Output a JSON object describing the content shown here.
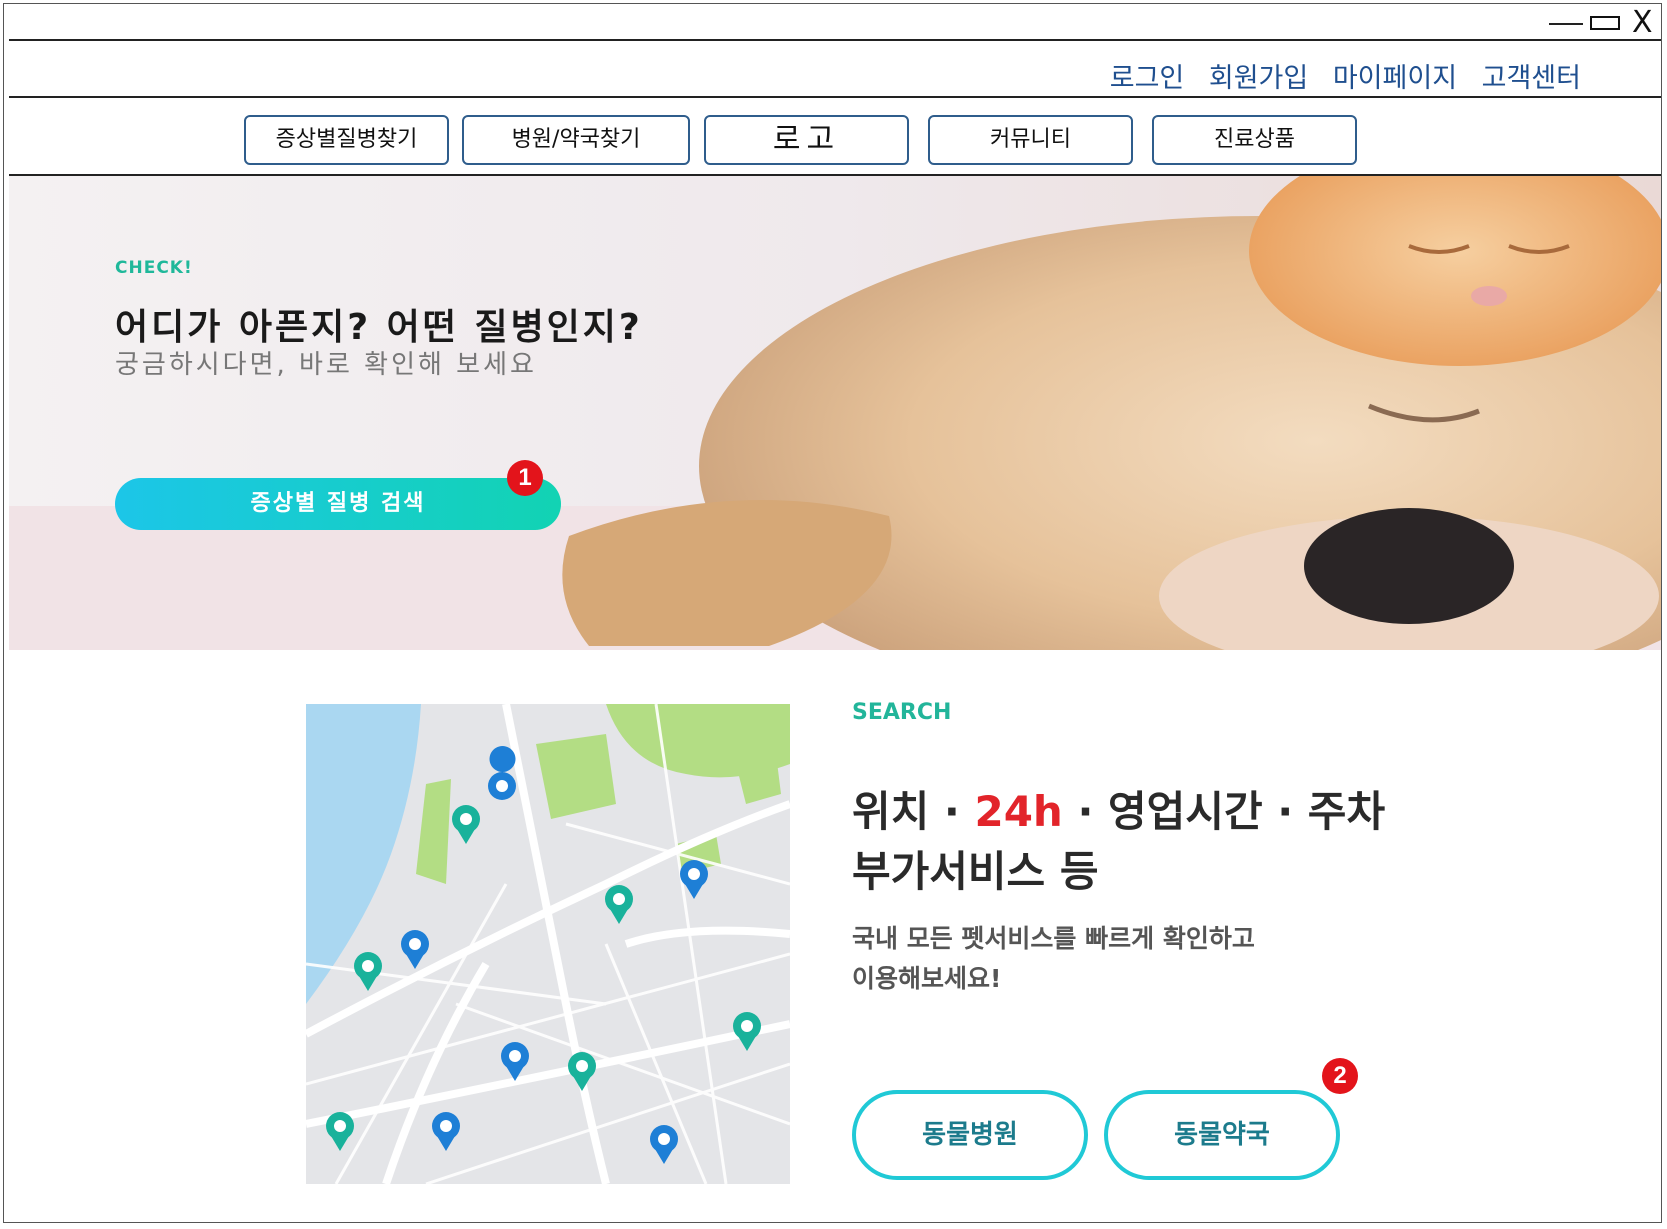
{
  "window": {
    "minimize_label": "—",
    "close_label": "X"
  },
  "top_links": [
    "로그인",
    "회원가입",
    "마이페이지",
    "고객센터"
  ],
  "nav": {
    "items": [
      "증상별질병찾기",
      "병원/약국찾기",
      "로고",
      "커뮤니티",
      "진료상품"
    ]
  },
  "hero": {
    "kicker": "CHECK!",
    "title": "어디가 아픈지? 어떤 질병인지?",
    "subtitle": "궁금하시다면, 바로 확인해 보세요",
    "button_label": "증상별 질병 검색",
    "marker": "1"
  },
  "search": {
    "kicker": "SEARCH",
    "title_part1": "위치 · ",
    "title_highlight": "24h",
    "title_part2": " · 영업시간 · 주차",
    "title_line2": "부가서비스 등",
    "desc_line1": "국내 모든 펫서비스를 빠르게 확인하고",
    "desc_line2": "이용해보세요!",
    "buttons": [
      "동물병원",
      "동물약국"
    ],
    "marker": "2",
    "accent_color": "#e2242a"
  }
}
